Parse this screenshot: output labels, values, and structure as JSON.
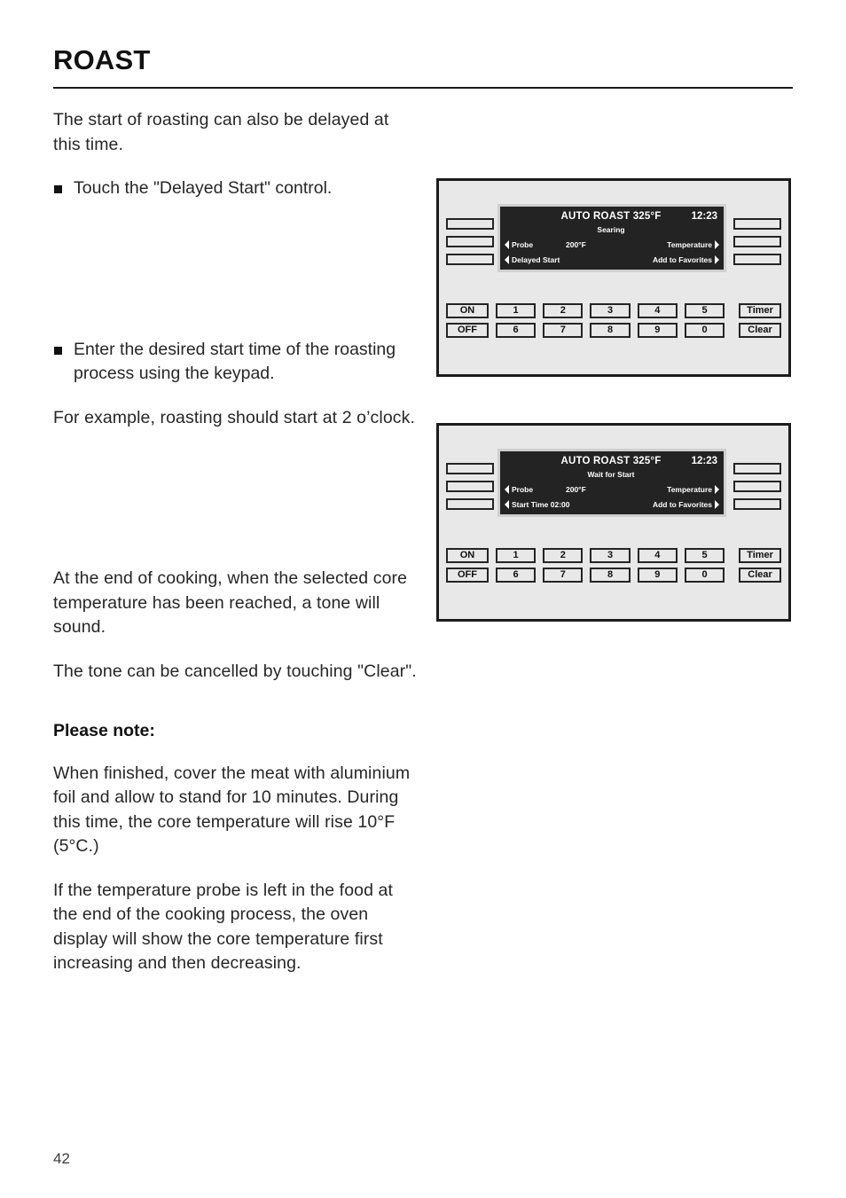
{
  "document": {
    "title": "ROAST",
    "page_number": "42"
  },
  "body": {
    "paragraph_1": "The start of roasting can also be delayed at this time.",
    "bullet_1": "Touch the \"Delayed Start\" control.",
    "bullet_2": "Enter the desired start time of the roasting process using the keypad.",
    "paragraph_2": "For example, roasting should start at 2 o’clock.",
    "paragraph_3": "At the end of cooking, when the selected core temperature has been reached, a tone will sound.",
    "paragraph_4": "The tone can be cancelled by touching \"Clear\".",
    "note_heading": "Please note:",
    "paragraph_5": "When finished, cover the meat with aluminium foil and allow to stand for 10 minutes. During this time, the core temperature will rise 10°F (5°C.)",
    "paragraph_6": "If the temperature probe is left in the food at the end of the cooking process, the oven display will show the core temperature first increasing and then decreasing."
  },
  "panels": [
    {
      "id": "panel-delayed-start",
      "display": {
        "title": "AUTO ROAST 325°F",
        "clock": "12:23",
        "subtitle": "Searing",
        "row1_left": "Probe",
        "row1_value": "200°F",
        "row1_right": "Temperature",
        "row2_left": "Delayed Start",
        "row2_right": "Add to Favorites"
      }
    },
    {
      "id": "panel-wait-for-start",
      "display": {
        "title": "AUTO ROAST 325°F",
        "clock": "12:23",
        "subtitle": "Wait for Start",
        "row1_left": "Probe",
        "row1_value": "200°F",
        "row1_right": "Temperature",
        "row2_left": "Start Time 02:00",
        "row2_right": "Add to Favorites"
      }
    }
  ],
  "controls": {
    "power": {
      "on": "ON",
      "off": "OFF"
    },
    "numbers_row1": [
      "1",
      "2",
      "3",
      "4",
      "5"
    ],
    "numbers_row2": [
      "6",
      "7",
      "8",
      "9",
      "0"
    ],
    "functions": {
      "timer": "Timer",
      "clear": "Clear"
    }
  },
  "colors": {
    "panel_background": "#e8e8e8",
    "panel_border": "#1c1c1c",
    "display_background": "#232323",
    "display_text": "#ffffff",
    "page_background": "#ffffff"
  }
}
